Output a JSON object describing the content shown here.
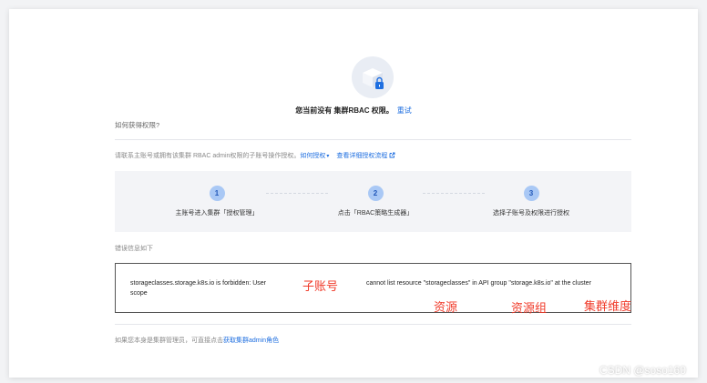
{
  "headline": {
    "text": "您当前没有 集群RBAC 权限。",
    "retry": "重试"
  },
  "how_title": "如何获得权限?",
  "contact": {
    "text": "请联系主账号或拥有该集群 RBAC admin权限的子账号操作授权。",
    "how_link": "如何授权",
    "detail_link": "查看详细授权流程"
  },
  "steps": [
    {
      "num": "1",
      "label": "主账号进入集群「授权管理」"
    },
    {
      "num": "2",
      "label": "点击「RBAC策略生成器」"
    },
    {
      "num": "3",
      "label": "选择子账号及权限进行授权"
    }
  ],
  "error_title": "错误信息如下",
  "error": {
    "line1_left": "storageclasses.storage.k8s.io is forbidden: User",
    "line1_right": "cannot list resource \"storageclasses\" in API group \"storage.k8s.io\" at the cluster",
    "line2": "scope"
  },
  "annotations": {
    "subaccount": "子账号",
    "resource": "资源",
    "resource_group": "资源组",
    "cluster_dimension": "集群维度"
  },
  "footer": {
    "text": "如果您本身是集群管理员，可直接点击",
    "link": "获取集群admin角色"
  },
  "watermark": "CSDN @soso160",
  "colors": {
    "link": "#1f6fe0",
    "annotation": "#f03b2a",
    "step_circle": "#a9c8f5"
  }
}
